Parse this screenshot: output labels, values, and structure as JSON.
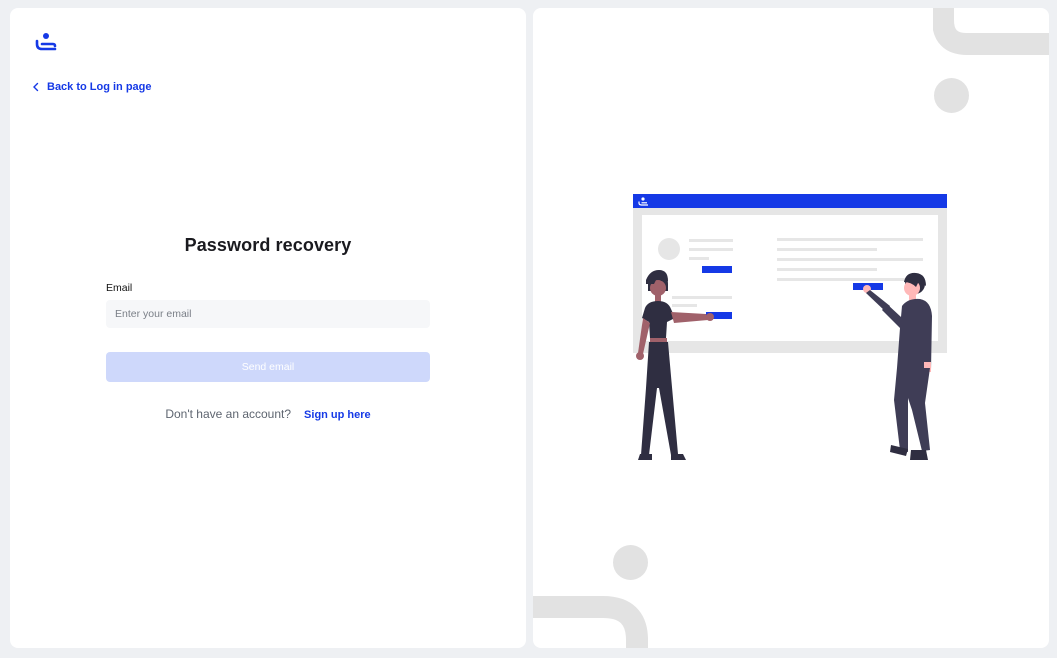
{
  "brand": {
    "accent": "#1539e6",
    "logo_icon": "person-at-desk-logo-icon"
  },
  "nav": {
    "back_label": "Back to Log in page",
    "back_icon": "chevron-left-icon"
  },
  "form": {
    "title": "Password recovery",
    "email_label": "Email",
    "email_placeholder": "Enter your email",
    "email_value": "",
    "submit_label": "Send email",
    "submit_state": "disabled"
  },
  "signup": {
    "prompt": "Don't have an account?",
    "link_label": "Sign up here"
  },
  "illustration": {
    "icon": "team-collaboration-illustration"
  }
}
